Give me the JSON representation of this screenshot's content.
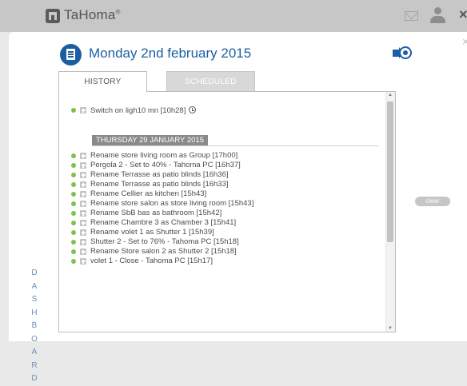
{
  "header": {
    "brand": "TaHoma",
    "brand_mark": "®",
    "icons": [
      "home-icon",
      "mail-icon",
      "user-icon",
      "close-icon"
    ],
    "close_glyph": "×"
  },
  "page": {
    "title": "Monday 2nd february 2015",
    "side_label": [
      "D",
      "A",
      "S",
      "H",
      "B",
      "O",
      "A",
      "R",
      "D"
    ],
    "clear_label": "clear"
  },
  "tabs": {
    "history": "HISTORY",
    "scheduled": "SCHEDULED",
    "active": "HISTORY"
  },
  "history": {
    "current_entries": [
      {
        "text": "Switch on ligh10 mn  [10h28]",
        "scheduled_icon": "clock-icon"
      }
    ],
    "date_header": "THURSDAY 29 JANUARY 2015",
    "entries": [
      "Rename store living room as Group  [17h00]",
      "Pergola 2 - Set to 40% - Tahoma PC  [16h37]",
      "Rename Terrasse as patio blinds  [16h36]",
      "Rename Terrasse as patio blinds  [16h33]",
      "Rename Cellier as kitchen  [15h43]",
      "Rename store salon as store living room  [15h43]",
      "Rename SbB bas as bathroom  [15h42]",
      "Rename Chambre 3 as Chamber 3  [15h41]",
      "Rename volet 1 as Shutter 1  [15h39]",
      "Shutter 2 - Set to 76% - Tahoma PC  [15h18]",
      "Rename Store salon 2 as Shutter 2  [15h18]",
      "volet 1 - Close - Tahoma PC  [15h17]"
    ]
  },
  "colors": {
    "accent": "#1c5ea4",
    "status_ok": "#7ec24c",
    "side_label": "#6e8fb6"
  }
}
